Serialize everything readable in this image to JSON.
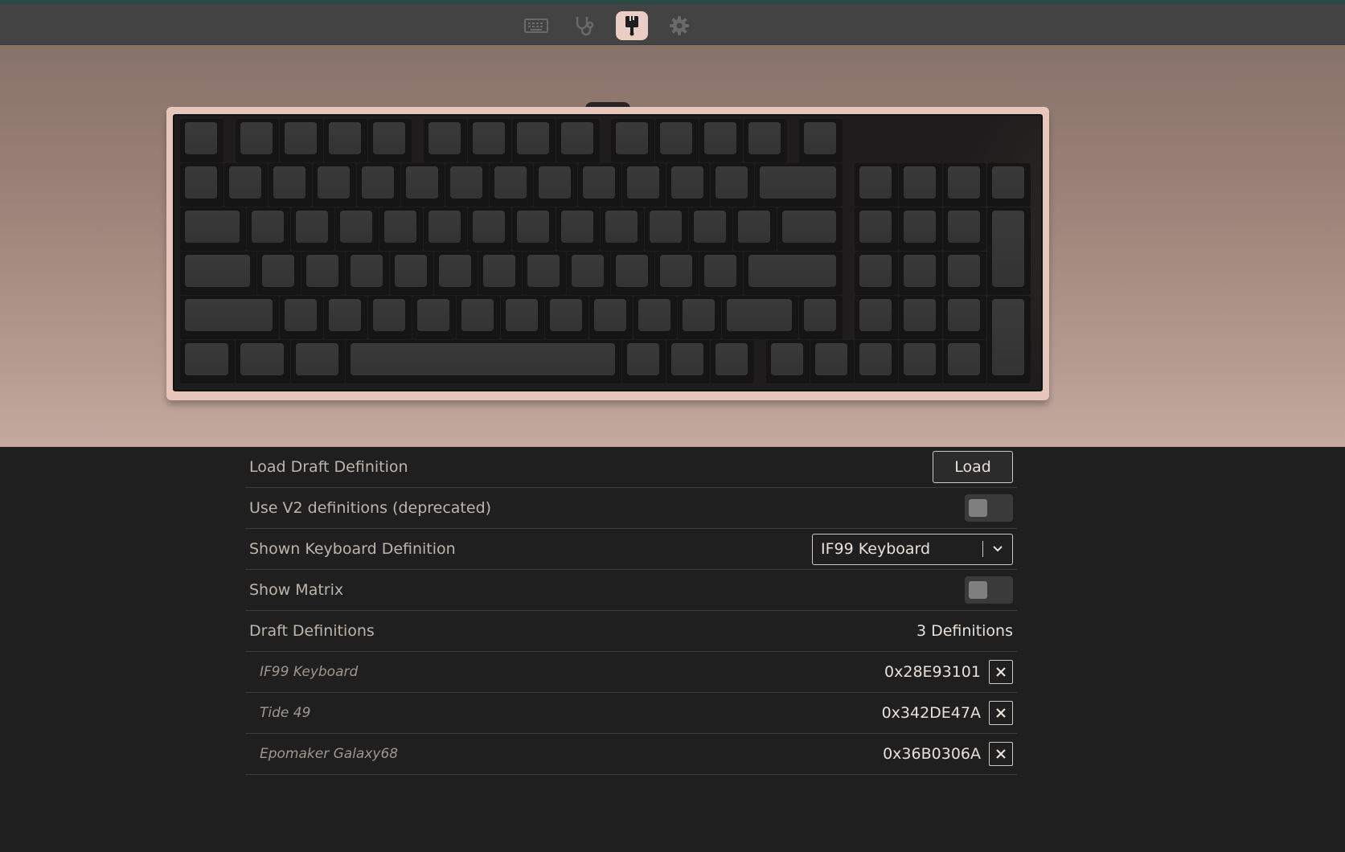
{
  "nav": {
    "items": [
      {
        "icon": "keyboard-icon",
        "active": false
      },
      {
        "icon": "stethoscope-icon",
        "active": false
      },
      {
        "icon": "paintbrush-icon",
        "active": true
      },
      {
        "icon": "gear-icon",
        "active": false
      }
    ],
    "active_color": "#eacdc4"
  },
  "keyboard": {
    "case_color": "#e7c7bb",
    "keycap_color": "#363636"
  },
  "settings": {
    "load_draft": {
      "label": "Load Draft Definition",
      "button": "Load"
    },
    "v2_defs": {
      "label": "Use V2 definitions (deprecated)",
      "enabled": false
    },
    "shown_def": {
      "label": "Shown Keyboard Definition",
      "value": "IF99 Keyboard"
    },
    "show_matrix": {
      "label": "Show Matrix",
      "enabled": false
    },
    "drafts": {
      "label": "Draft Definitions",
      "count": "3 Definitions"
    },
    "definitions": [
      {
        "name": "IF99 Keyboard",
        "id": "0x28E93101"
      },
      {
        "name": "Tide 49",
        "id": "0x342DE47A"
      },
      {
        "name": "Epomaker Galaxy68",
        "id": "0x36B0306A"
      }
    ]
  }
}
